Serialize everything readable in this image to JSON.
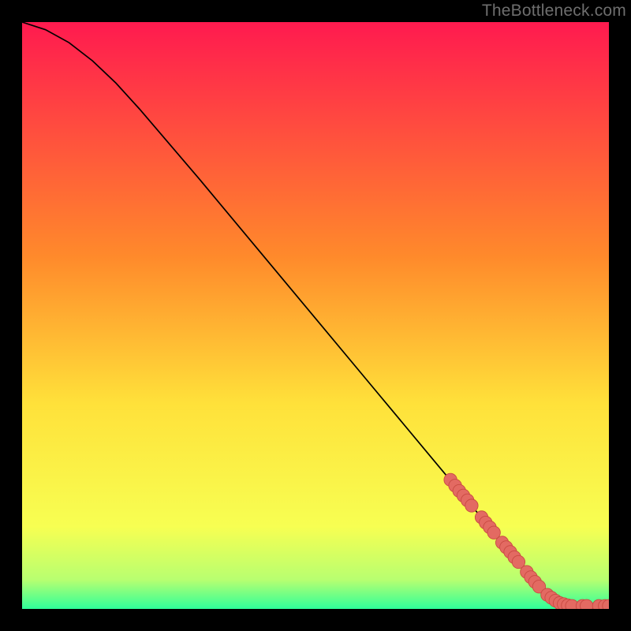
{
  "watermark": "TheBottleneck.com",
  "colors": {
    "background": "#000000",
    "curve": "#000000",
    "point_fill": "#e36a62",
    "point_stroke": "#c94a42",
    "grad_top": "#ff1a4f",
    "grad_mid1": "#ff8a2b",
    "grad_mid2": "#ffe13a",
    "grad_mid3": "#f7ff52",
    "grad_mid4": "#b8ff70",
    "grad_bottom": "#2fff9a"
  },
  "chart_data": {
    "type": "line",
    "title": "",
    "xlabel": "",
    "ylabel": "",
    "xlim": [
      0,
      100
    ],
    "ylim": [
      0,
      100
    ],
    "curve": [
      {
        "x": 0,
        "y": 100
      },
      {
        "x": 4,
        "y": 98.7
      },
      {
        "x": 8,
        "y": 96.5
      },
      {
        "x": 12,
        "y": 93.4
      },
      {
        "x": 16,
        "y": 89.6
      },
      {
        "x": 20,
        "y": 85.2
      },
      {
        "x": 30,
        "y": 73.5
      },
      {
        "x": 40,
        "y": 61.5
      },
      {
        "x": 50,
        "y": 49.5
      },
      {
        "x": 60,
        "y": 37.5
      },
      {
        "x": 70,
        "y": 25.5
      },
      {
        "x": 78,
        "y": 15.9
      },
      {
        "x": 84,
        "y": 8.7
      },
      {
        "x": 88,
        "y": 4.0
      },
      {
        "x": 90,
        "y": 2.2
      },
      {
        "x": 92,
        "y": 1.1
      },
      {
        "x": 94,
        "y": 0.6
      },
      {
        "x": 96,
        "y": 0.5
      },
      {
        "x": 98,
        "y": 0.5
      },
      {
        "x": 100,
        "y": 0.5
      }
    ],
    "points": [
      {
        "x": 73.0,
        "y": 22.0
      },
      {
        "x": 73.8,
        "y": 21.0
      },
      {
        "x": 74.5,
        "y": 20.1
      },
      {
        "x": 75.2,
        "y": 19.3
      },
      {
        "x": 75.9,
        "y": 18.5
      },
      {
        "x": 76.6,
        "y": 17.6
      },
      {
        "x": 78.3,
        "y": 15.6
      },
      {
        "x": 79.0,
        "y": 14.7
      },
      {
        "x": 79.7,
        "y": 13.9
      },
      {
        "x": 80.4,
        "y": 13.0
      },
      {
        "x": 81.8,
        "y": 11.3
      },
      {
        "x": 82.5,
        "y": 10.5
      },
      {
        "x": 83.2,
        "y": 9.7
      },
      {
        "x": 83.9,
        "y": 8.8
      },
      {
        "x": 84.6,
        "y": 8.0
      },
      {
        "x": 86.0,
        "y": 6.3
      },
      {
        "x": 86.7,
        "y": 5.4
      },
      {
        "x": 87.4,
        "y": 4.6
      },
      {
        "x": 88.1,
        "y": 3.8
      },
      {
        "x": 89.5,
        "y": 2.4
      },
      {
        "x": 90.2,
        "y": 1.9
      },
      {
        "x": 90.9,
        "y": 1.4
      },
      {
        "x": 91.6,
        "y": 1.0
      },
      {
        "x": 92.3,
        "y": 0.8
      },
      {
        "x": 93.0,
        "y": 0.6
      },
      {
        "x": 93.7,
        "y": 0.5
      },
      {
        "x": 95.5,
        "y": 0.5
      },
      {
        "x": 96.2,
        "y": 0.5
      },
      {
        "x": 98.3,
        "y": 0.5
      },
      {
        "x": 99.3,
        "y": 0.5
      },
      {
        "x": 100.0,
        "y": 0.5
      }
    ],
    "point_radius": 1.1
  }
}
